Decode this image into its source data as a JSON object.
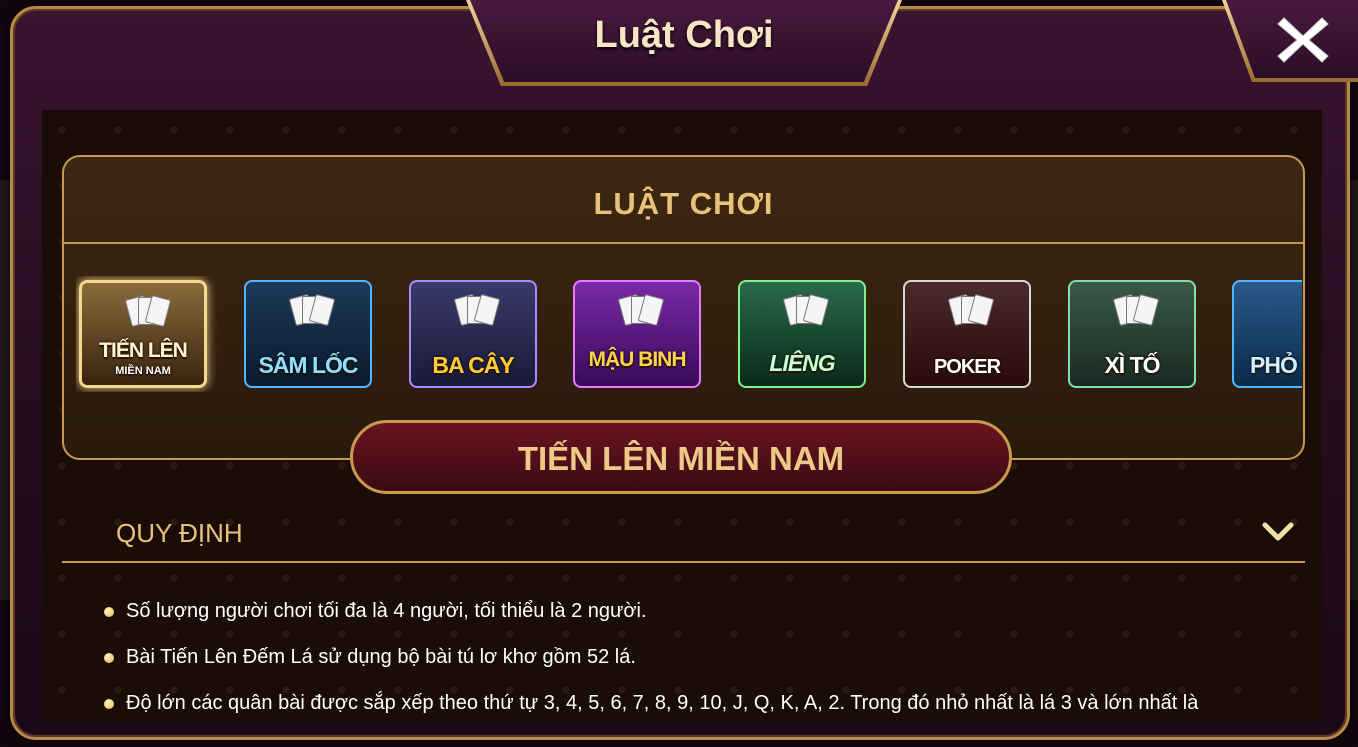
{
  "window": {
    "title": "Luật Chơi"
  },
  "panel": {
    "title": "LUẬT CHƠI"
  },
  "games": [
    {
      "label": "TIẾN LÊN",
      "sublabel": "MIỀN NAM",
      "selected": true,
      "accent": "#f4d88c"
    },
    {
      "label": "SÂM LỐC",
      "selected": false,
      "accent": "#4fb6ff"
    },
    {
      "label": "BA CÂY",
      "selected": false,
      "accent": "#a98cff"
    },
    {
      "label": "MẬU BINH",
      "selected": false,
      "accent": "#e67cff"
    },
    {
      "label": "LIÊNG",
      "selected": false,
      "accent": "#7ff08a"
    },
    {
      "label": "POKER",
      "selected": false,
      "accent": "#d8d8d8"
    },
    {
      "label": "XÌ TỐ",
      "selected": false,
      "accent": "#7fe0a8"
    },
    {
      "label": "PHỎ",
      "selected": false,
      "accent": "#4fb6ff"
    }
  ],
  "selected_game_title": "TIẾN LÊN MIỀN NAM",
  "section": {
    "label": "QUY ĐỊNH",
    "expanded_icon": "chevron-down-icon"
  },
  "rules": [
    "Số lượng người chơi tối đa là 4 người, tối thiểu là 2 người.",
    "Bài Tiến Lên Đếm Lá sử dụng bộ bài tú lơ khơ gồm 52 lá.",
    "Độ lớn các quân bài được sắp xếp theo thứ tự 3, 4, 5, 6, 7, 8, 9, 10, J, Q, K, A, 2. Trong đó nhỏ nhất là lá 3 và lớn nhất là"
  ],
  "colors": {
    "gold": "#c99a4e",
    "title_gold": "#e8c27a",
    "frame_purple": "#2a0e24"
  }
}
